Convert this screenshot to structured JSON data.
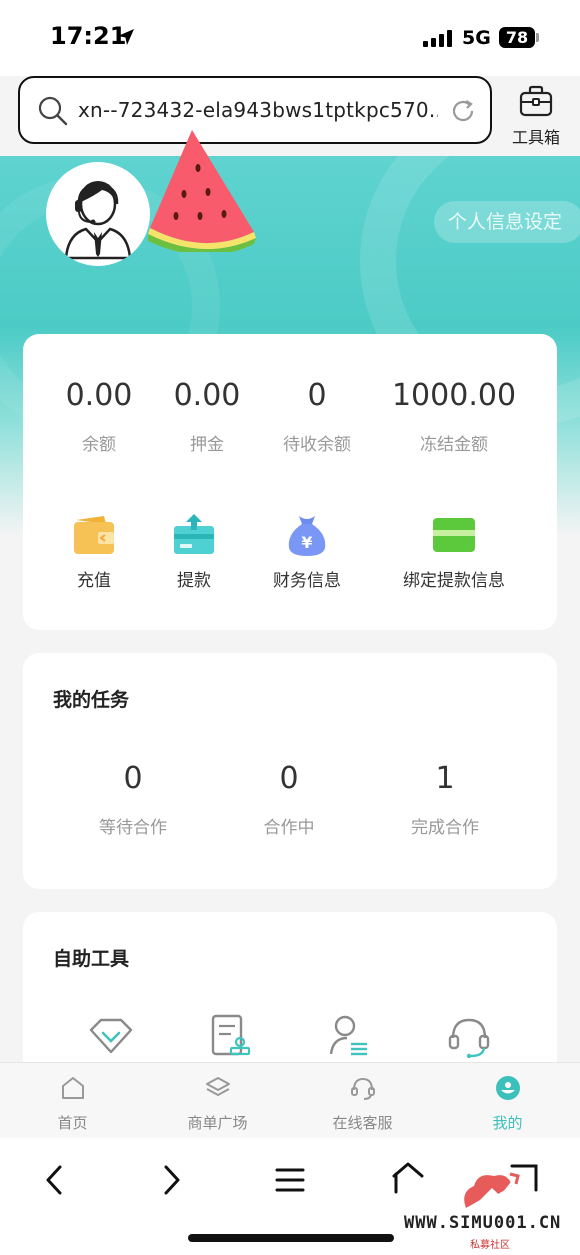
{
  "status_bar": {
    "time": "17:21",
    "network": "5G",
    "battery": "78"
  },
  "address_bar": {
    "url": "xn--723432-ela943bws1tptkpc570...",
    "toolbox_label": "工具箱"
  },
  "profile": {
    "settings_button": "个人信息设定"
  },
  "balance": {
    "stats": [
      {
        "value": "0.00",
        "label": "余额"
      },
      {
        "value": "0.00",
        "label": "押金"
      },
      {
        "value": "0",
        "label": "待收余额"
      },
      {
        "value": "1000.00",
        "label": "冻结金额"
      }
    ],
    "actions": [
      {
        "label": "充值",
        "icon": "wallet-icon"
      },
      {
        "label": "提款",
        "icon": "withdraw-icon"
      },
      {
        "label": "财务信息",
        "icon": "money-bag-icon"
      },
      {
        "label": "绑定提款信息",
        "icon": "card-icon"
      }
    ]
  },
  "tasks": {
    "title": "我的任务",
    "items": [
      {
        "value": "0",
        "label": "等待合作"
      },
      {
        "value": "0",
        "label": "合作中"
      },
      {
        "value": "1",
        "label": "完成合作"
      }
    ]
  },
  "tools": {
    "title": "自助工具",
    "icons": [
      "diamond-icon",
      "document-stamp-icon",
      "user-list-icon",
      "headset-icon"
    ]
  },
  "tab_bar": {
    "tabs": [
      {
        "label": "首页",
        "icon": "home-icon",
        "active": false
      },
      {
        "label": "商单广场",
        "icon": "layers-icon",
        "active": false
      },
      {
        "label": "在线客服",
        "icon": "headset-icon",
        "active": false
      },
      {
        "label": "我的",
        "icon": "profile-icon",
        "active": true
      }
    ]
  },
  "watermark": {
    "text": "WWW.SIMU001.CN",
    "sub": "私募社区"
  },
  "colors": {
    "accent": "#45c8c3",
    "active_tab": "#3cc0bb"
  }
}
